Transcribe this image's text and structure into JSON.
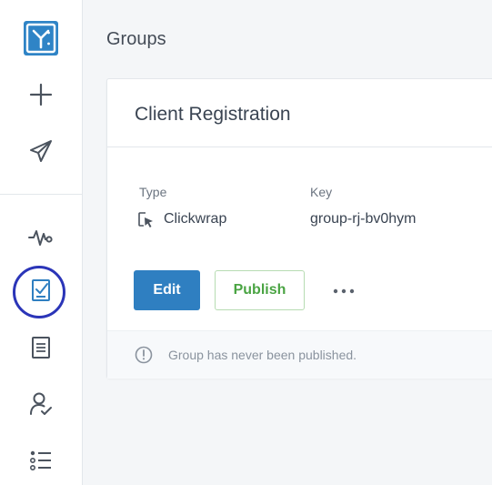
{
  "sidebar": {
    "logo_icon": "app-logo-icon",
    "items": [
      {
        "name": "create",
        "icon": "plus-icon"
      },
      {
        "name": "send",
        "icon": "paper-plane-icon"
      },
      {
        "name": "activity",
        "icon": "activity-icon"
      },
      {
        "name": "groups",
        "icon": "checklist-document-icon",
        "highlighted": true
      },
      {
        "name": "documents",
        "icon": "document-icon"
      },
      {
        "name": "users",
        "icon": "user-check-icon"
      },
      {
        "name": "list",
        "icon": "list-icon"
      }
    ],
    "highlight_color": "#2b35b8"
  },
  "page": {
    "title": "Groups"
  },
  "card": {
    "title": "Client Registration",
    "type_label": "Type",
    "type_value": "Clickwrap",
    "key_label": "Key",
    "key_value": "group-rj-bv0hym",
    "edit_label": "Edit",
    "publish_label": "Publish",
    "more_label": "•••",
    "footer_text": "Group has never been published."
  },
  "colors": {
    "accent": "#2f7fc1",
    "publish_green": "#4aa443",
    "text": "#3a4452"
  }
}
